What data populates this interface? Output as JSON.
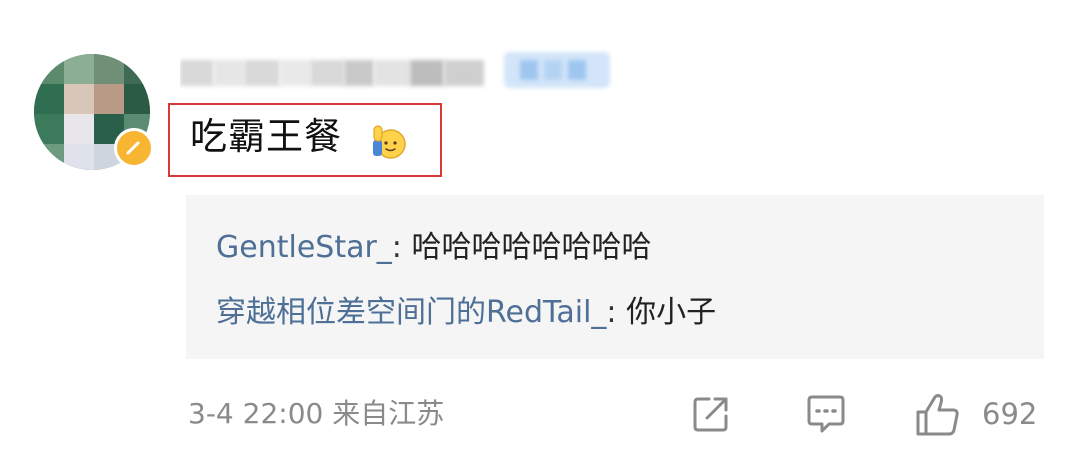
{
  "comment": {
    "text": "吃霸王餐",
    "emoji": "raising-hand-emoji"
  },
  "replies": [
    {
      "user": "GentleStar_",
      "separator": ":",
      "text": "哈哈哈哈哈哈哈哈"
    },
    {
      "user": "穿越相位差空间门的RedTail_",
      "separator": ":",
      "text": "你小子"
    }
  ],
  "footer": {
    "timestamp": "3-4 22:00",
    "source": "来自江苏",
    "like_count": "692",
    "icons": [
      "share-icon",
      "comment-icon",
      "like-icon"
    ]
  },
  "colors": {
    "highlight_border": "#d63a35",
    "reply_user": "#4e6f96",
    "meta_text": "#8a8a8a",
    "reply_bg": "#f5f5f5",
    "badge": "#f7b531"
  }
}
